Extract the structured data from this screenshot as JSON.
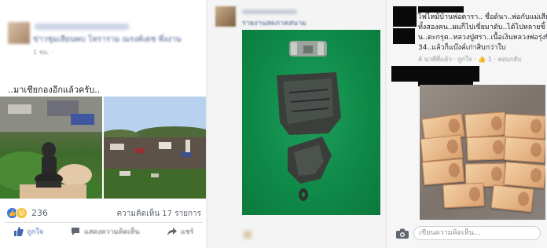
{
  "post1": {
    "page_name": "ข่าวชุมเลียนพบ โหราราม ณรงค์เดช พึ่งงาน",
    "meta": "1 ชม. · ",
    "text": "..มาเชียกองอีกแล้วครับ..",
    "reaction_count": "236",
    "comments_count": "ความคิดเห็น 17 รายการ",
    "actions": {
      "like": "ถูกใจ",
      "comment": "แสดงความคิดเห็น",
      "share": "แชร์"
    }
  },
  "post2": {
    "title": "รายงานสดภาคสนาม"
  },
  "post3": {
    "comment_lines": [
      "ไฟไหม้บ้านพ่อตารา.. ชื่อด้นา..พ่อกับแม่เสีย",
      "ทั้งสองคน..ผมก็ไปเขี่ยมาดับ..ได้ไปหลายชิ้",
      "น..ตะกรุด..หลวงปู่ศรา..เนื้อเงินหลวงพ่อรุ่งปี",
      "34..แล้วก็แบ๊งค์เก่าสิบกว่าใบ"
    ],
    "comment_meta": "4 นาทีที่แล้ว · ถูกใจ · 👍 1 · ตอบกลับ",
    "comment_placeholder": "เขียนความคิดเห็น..."
  },
  "colors": {
    "link_blue": "#4b5d8c",
    "like_blue": "#3b73e8",
    "green_backdrop": "#0f8a48"
  }
}
